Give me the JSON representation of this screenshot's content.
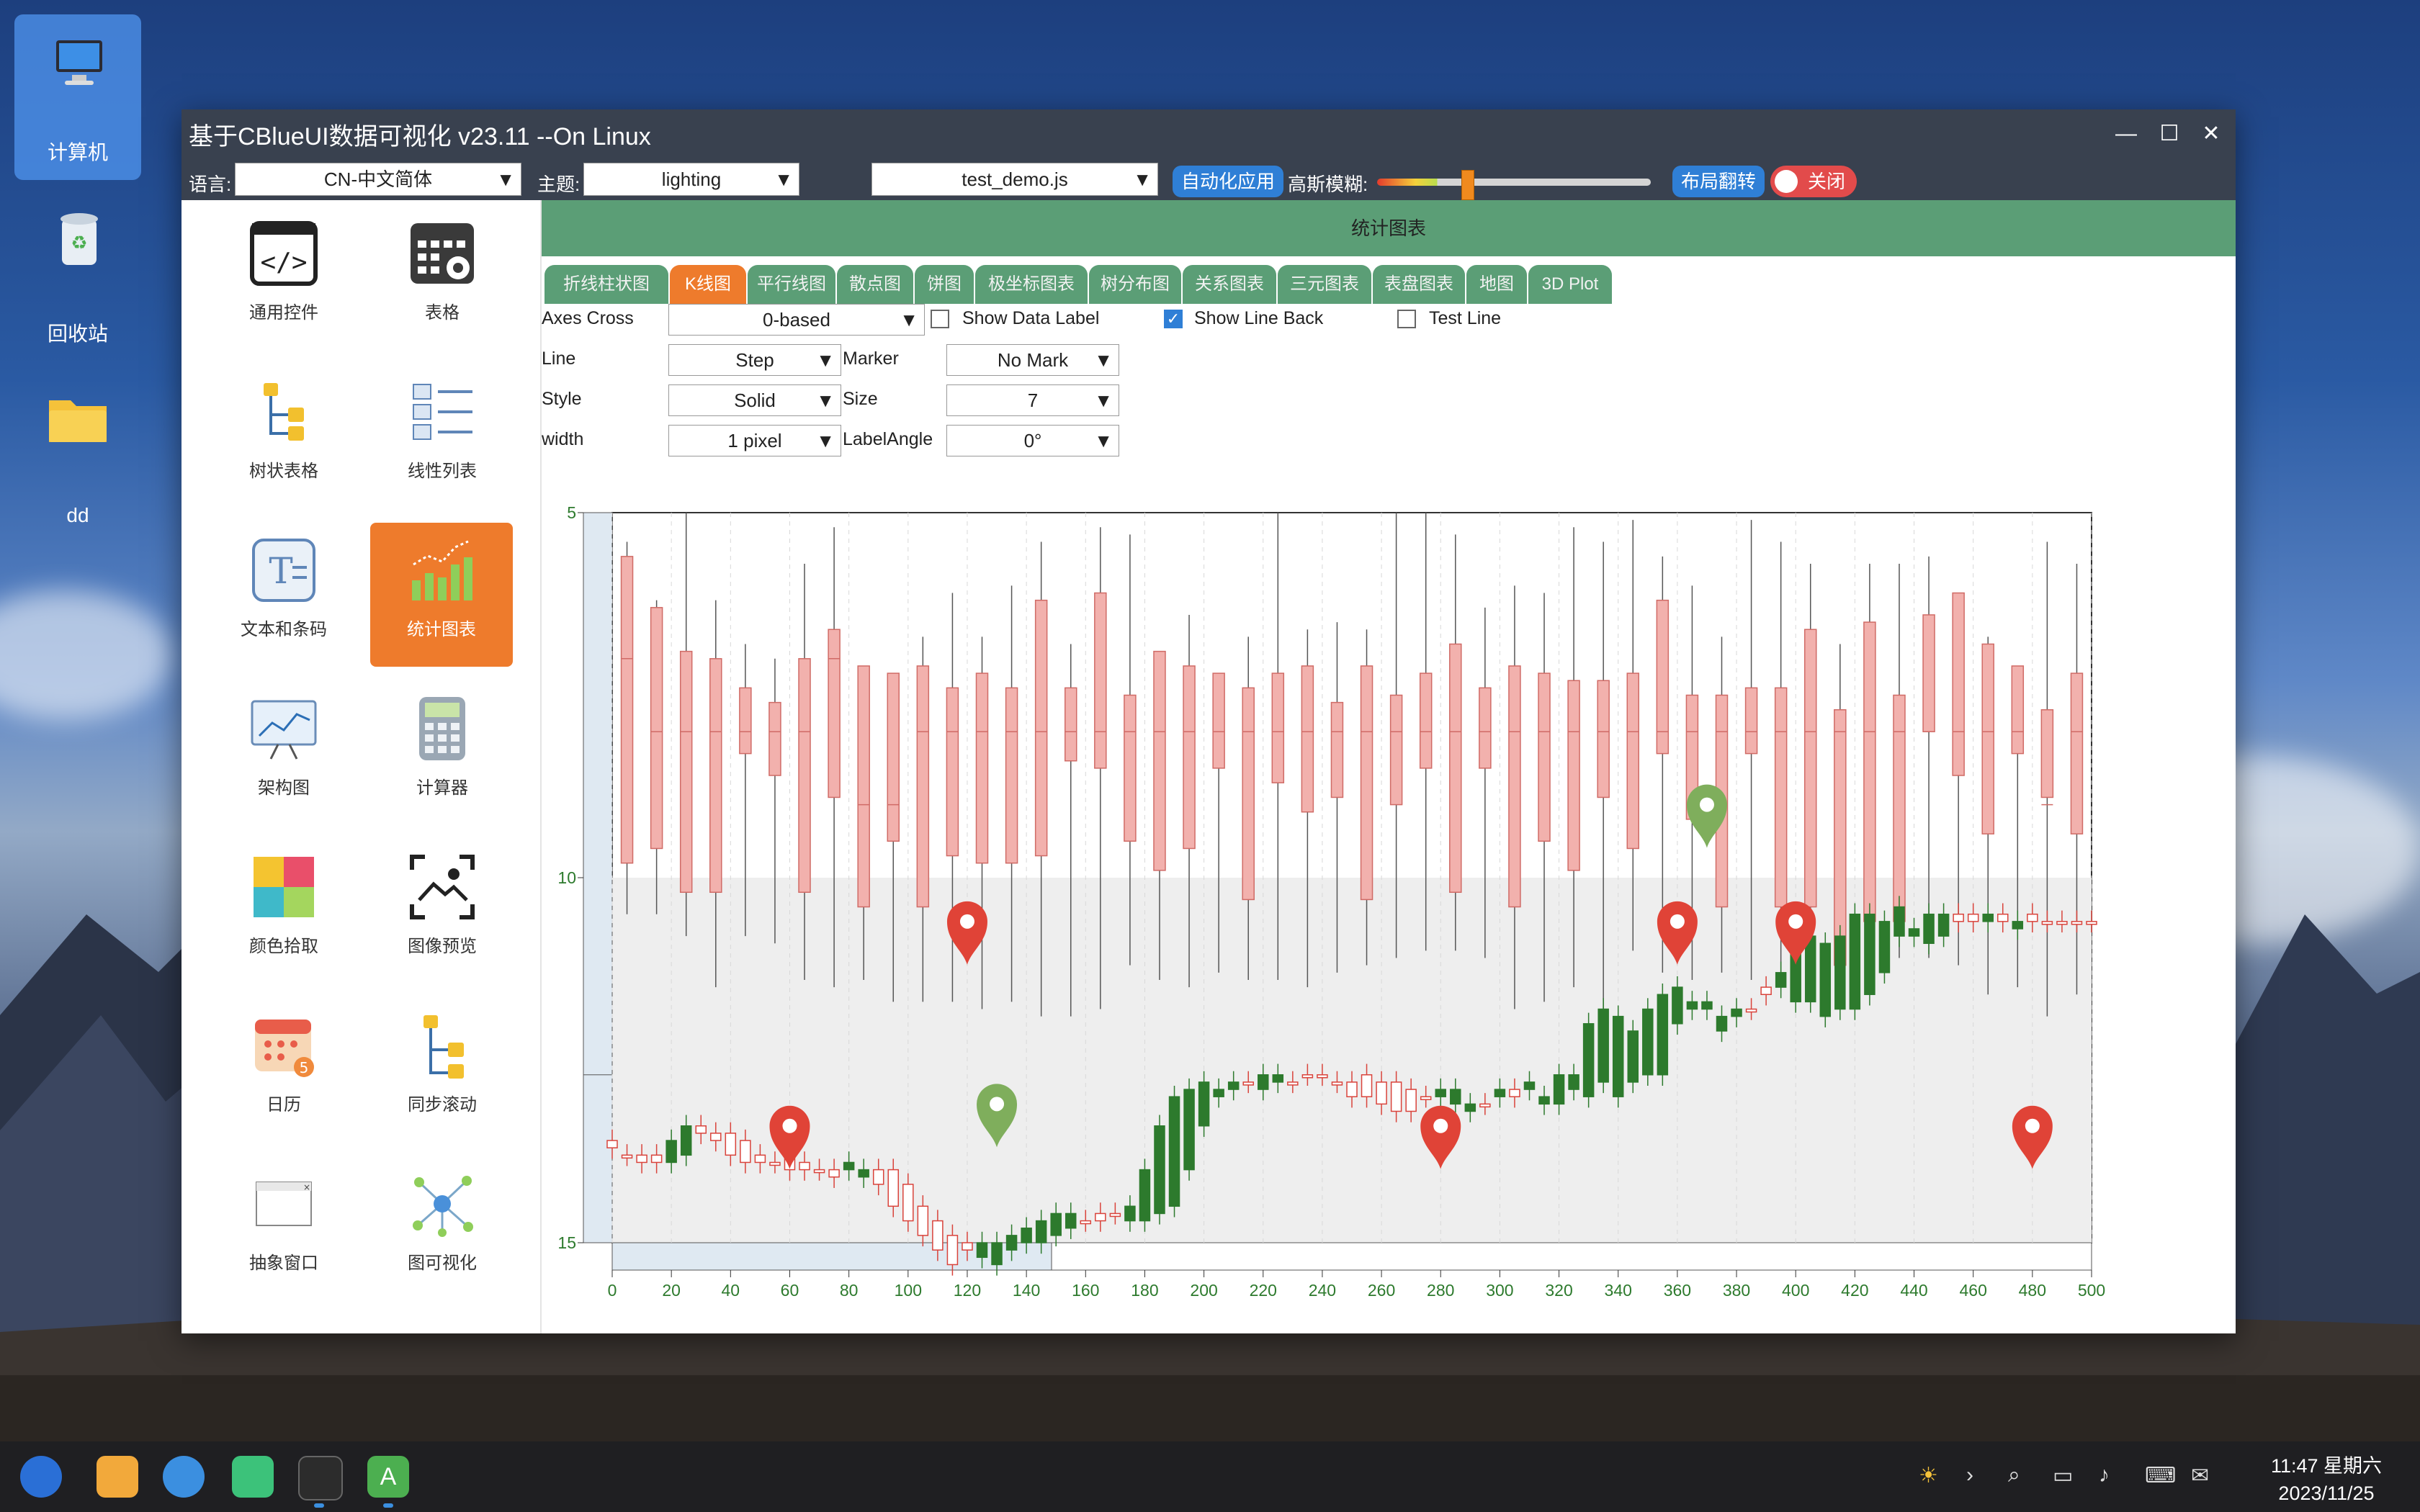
{
  "desktop": {
    "icons": [
      {
        "label": "计算机",
        "icon": "computer-icon"
      },
      {
        "label": "回收站",
        "icon": "trash-icon"
      },
      {
        "label": "dd",
        "icon": "folder-icon"
      }
    ]
  },
  "window": {
    "title": "基于CBlueUI数据可视化 v23.11 --On Linux",
    "controls": [
      "minimize-icon",
      "maximize-icon",
      "close-icon"
    ]
  },
  "toolbar": {
    "language_label": "语言:",
    "language_value": "CN-中文简体",
    "theme_label": "主题:",
    "theme_value": "lighting",
    "script_value": "test_demo.js",
    "auto_app_label": "自动化应用",
    "blur_label": "高斯模糊:",
    "blur_level": 0.33,
    "layout_flip_label": "布局翻转",
    "close_toggle_label": "关闭"
  },
  "nav": {
    "items": [
      {
        "label": "通用控件",
        "icon": "code-icon"
      },
      {
        "label": "表格",
        "icon": "table-settings-icon"
      },
      {
        "label": "树状表格",
        "icon": "tree-table-icon"
      },
      {
        "label": "线性列表",
        "icon": "list-icon"
      },
      {
        "label": "文本和条码",
        "icon": "text-icon"
      },
      {
        "label": "统计图表",
        "icon": "chart-icon"
      },
      {
        "label": "架构图",
        "icon": "architecture-icon"
      },
      {
        "label": "计算器",
        "icon": "calculator-icon"
      },
      {
        "label": "颜色拾取",
        "icon": "color-picker-icon"
      },
      {
        "label": "图像预览",
        "icon": "image-preview-icon"
      },
      {
        "label": "日历",
        "icon": "calendar-icon"
      },
      {
        "label": "同步滚动",
        "icon": "sync-scroll-icon"
      },
      {
        "label": "抽象窗口",
        "icon": "window-icon"
      },
      {
        "label": "图可视化",
        "icon": "graph-icon"
      }
    ],
    "calendar_badge": "5"
  },
  "main": {
    "header": "统计图表",
    "tabs": [
      "折线柱状图",
      "K线图",
      "平行线图",
      "散点图",
      "饼图",
      "极坐标图表",
      "树分布图",
      "关系图表",
      "三元图表",
      "表盘图表",
      "地图",
      "3D Plot"
    ],
    "active_tab": "K线图",
    "controls": {
      "axes_cross_label": "Axes Cross",
      "axes_cross_value": "0-based",
      "show_data_label": "Show Data Label",
      "show_line_back": "Show Line Back",
      "test_line": "Test Line",
      "line_label": "Line",
      "line_value": "Step",
      "marker_label": "Marker",
      "marker_value": "No Mark",
      "style_label": "Style",
      "style_value": "Solid",
      "size_label": "Size",
      "size_value": "7",
      "width_label": "width",
      "width_value": "1 pixel",
      "label_angle_label": "LabelAngle",
      "label_angle_value": "0°"
    }
  },
  "chart_data": {
    "type": "candlestick+boxplot",
    "x_ticks": [
      "0",
      "20",
      "40",
      "60",
      "80",
      "100",
      "120",
      "140",
      "160",
      "180",
      "200",
      "220",
      "240",
      "260",
      "280",
      "300",
      "320",
      "340",
      "360",
      "380",
      "400",
      "420",
      "440",
      "460",
      "480",
      "500"
    ],
    "y_ticks": [
      "5",
      "10",
      "15"
    ],
    "xlim": [
      0,
      500
    ],
    "ylim": [
      5,
      15
    ],
    "y_inverted": true,
    "boxplot_series": {
      "x": [
        0,
        10,
        20,
        30,
        40,
        50,
        60,
        70,
        80,
        90,
        100,
        110,
        120,
        130,
        140,
        150,
        160,
        170,
        180,
        190,
        200,
        210,
        220,
        230,
        240,
        250,
        260,
        270,
        280,
        290,
        300,
        310,
        320,
        330,
        340,
        350,
        360,
        370,
        380,
        390,
        400,
        410,
        420,
        430,
        440,
        450,
        460,
        470,
        480,
        490
      ],
      "q1": [
        5.6,
        6.3,
        6.9,
        7.0,
        7.4,
        7.6,
        7.0,
        6.6,
        7.1,
        7.2,
        7.1,
        7.4,
        7.2,
        7.4,
        6.2,
        7.4,
        6.1,
        7.5,
        6.9,
        7.1,
        7.2,
        7.4,
        7.2,
        7.1,
        7.6,
        7.1,
        7.5,
        7.2,
        6.8,
        7.4,
        7.1,
        7.2,
        7.3,
        7.3,
        7.2,
        6.2,
        7.5,
        7.5,
        7.4,
        7.4,
        6.6,
        7.7,
        6.5,
        7.5,
        6.4,
        6.1,
        6.8,
        7.1,
        7.7,
        7.2
      ],
      "median": [
        7.0,
        8.0,
        8.0,
        8.0,
        8.0,
        8.0,
        8.0,
        7.0,
        9.0,
        9.0,
        8.0,
        8.0,
        8.0,
        8.0,
        8.0,
        8.0,
        8.0,
        8.0,
        8.0,
        8.0,
        8.0,
        8.0,
        8.0,
        8.0,
        8.0,
        8.0,
        8.0,
        8.0,
        8.0,
        8.0,
        8.0,
        8.0,
        8.0,
        8.0,
        8.0,
        8.0,
        8.0,
        8.0,
        8.0,
        8.0,
        8.0,
        8.0,
        8.0,
        8.0,
        8.0,
        8.0,
        8.0,
        8.0,
        9.0,
        8.0
      ],
      "q3": [
        9.8,
        9.6,
        10.2,
        10.2,
        8.3,
        8.6,
        10.2,
        8.9,
        10.4,
        9.5,
        10.4,
        9.7,
        9.8,
        9.8,
        9.7,
        8.4,
        8.5,
        9.5,
        9.9,
        9.6,
        8.5,
        10.3,
        8.7,
        9.1,
        8.9,
        10.3,
        9.0,
        8.5,
        10.2,
        8.5,
        10.4,
        9.5,
        9.9,
        8.9,
        9.6,
        8.3,
        9.2,
        10.4,
        8.3,
        10.4,
        10.4,
        11.2,
        10.6,
        10.6,
        8.0,
        8.6,
        9.4,
        8.3,
        8.9,
        9.4
      ],
      "whisker_low": [
        10.5,
        10.5,
        10.8,
        11.5,
        10.8,
        10.9,
        11.4,
        11.5,
        11.4,
        11.7,
        11.7,
        11.7,
        11.8,
        11.7,
        11.9,
        11.9,
        11.8,
        11.2,
        11.4,
        11.5,
        11.3,
        11.4,
        11.4,
        11.5,
        11.3,
        11.2,
        11.1,
        11.0,
        11.0,
        11.1,
        11.8,
        11.7,
        11.5,
        11.8,
        11.0,
        11.3,
        11.4,
        11.3,
        11.4,
        11.4,
        11.7,
        11.8,
        11.0,
        11.1,
        11.1,
        11.2,
        11.6,
        11.5,
        11.9,
        11.6
      ],
      "whisker_high": [
        5.4,
        6.2,
        5.0,
        6.2,
        6.8,
        7.0,
        5.7,
        5.2,
        7.5,
        7.5,
        6.7,
        6.1,
        6.7,
        6.0,
        5.4,
        6.8,
        5.2,
        5.3,
        6.9,
        6.4,
        7.5,
        6.7,
        5.0,
        6.6,
        6.5,
        6.6,
        5.0,
        5.0,
        5.3,
        6.3,
        6.0,
        6.1,
        5.2,
        5.4,
        5.1,
        5.6,
        6.0,
        6.7,
        5.1,
        5.4,
        5.7,
        6.8,
        5.7,
        5.7,
        5.6,
        6.8,
        6.7,
        7.2,
        5.4,
        5.7
      ]
    },
    "candlestick_series": {
      "x": [
        0,
        5,
        10,
        15,
        20,
        25,
        30,
        35,
        40,
        45,
        50,
        55,
        60,
        65,
        70,
        75,
        80,
        85,
        90,
        95,
        100,
        105,
        110,
        115,
        120,
        125,
        130,
        135,
        140,
        145,
        150,
        155,
        160,
        165,
        170,
        175,
        180,
        185,
        190,
        195,
        200,
        205,
        210,
        215,
        220,
        225,
        230,
        235,
        240,
        245,
        250,
        255,
        260,
        265,
        270,
        275,
        280,
        285,
        290,
        295,
        300,
        305,
        310,
        315,
        320,
        325,
        330,
        335,
        340,
        345,
        350,
        355,
        360,
        365,
        370,
        375,
        380,
        385,
        390,
        395,
        400,
        405,
        410,
        415,
        420,
        425,
        430,
        435,
        440,
        445,
        450,
        455,
        460,
        465,
        470,
        475,
        480,
        485,
        490,
        495,
        500
      ],
      "open": [
        13.6,
        13.8,
        13.8,
        13.8,
        13.9,
        13.8,
        13.4,
        13.5,
        13.5,
        13.6,
        13.8,
        13.9,
        13.8,
        13.9,
        14.0,
        14.0,
        14.0,
        14.1,
        14.0,
        14.0,
        14.2,
        14.5,
        14.7,
        14.9,
        15.0,
        15.2,
        15.3,
        15.1,
        15.0,
        15.0,
        14.9,
        14.8,
        14.7,
        14.6,
        14.6,
        14.7,
        14.7,
        14.6,
        14.5,
        14.0,
        13.4,
        13.0,
        12.9,
        12.8,
        12.9,
        12.8,
        12.8,
        12.7,
        12.7,
        12.8,
        12.8,
        12.7,
        12.8,
        12.8,
        12.9,
        13.0,
        13.0,
        13.1,
        13.2,
        13.1,
        13.0,
        12.9,
        12.9,
        13.1,
        13.1,
        12.9,
        13.0,
        12.8,
        13.0,
        12.8,
        12.7,
        12.7,
        12.0,
        11.8,
        11.8,
        12.1,
        11.9,
        11.8,
        11.5,
        11.5,
        11.7,
        11.7,
        11.9,
        11.8,
        11.8,
        11.6,
        11.3,
        10.8,
        10.8,
        10.9,
        10.8,
        10.5,
        10.5,
        10.6,
        10.5,
        10.7,
        10.5,
        10.6,
        10.6,
        10.6,
        10.6
      ],
      "close": [
        13.7,
        13.8,
        13.9,
        13.9,
        13.6,
        13.4,
        13.5,
        13.6,
        13.8,
        13.9,
        13.9,
        13.9,
        14.0,
        14.0,
        14.0,
        14.1,
        13.9,
        14.0,
        14.2,
        14.5,
        14.7,
        14.9,
        15.1,
        15.3,
        15.1,
        15.0,
        15.0,
        14.9,
        14.8,
        14.7,
        14.6,
        14.6,
        14.7,
        14.7,
        14.6,
        14.5,
        14.0,
        13.4,
        13.0,
        12.9,
        12.8,
        12.9,
        12.8,
        12.8,
        12.7,
        12.7,
        12.8,
        12.7,
        12.7,
        12.8,
        13.0,
        13.0,
        13.1,
        13.2,
        13.2,
        13.0,
        12.9,
        12.9,
        13.1,
        13.1,
        12.9,
        13.0,
        12.8,
        13.0,
        12.7,
        12.7,
        12.0,
        11.8,
        11.9,
        12.1,
        11.8,
        11.6,
        11.5,
        11.7,
        11.7,
        11.9,
        11.8,
        11.8,
        11.6,
        11.3,
        10.9,
        10.8,
        10.9,
        10.8,
        10.5,
        10.5,
        10.6,
        10.4,
        10.7,
        10.5,
        10.5,
        10.6,
        10.6,
        10.5,
        10.6,
        10.6,
        10.6,
        10.6,
        10.6,
        10.6,
        10.6
      ]
    },
    "map_markers": [
      {
        "x": 60,
        "y": 13.4,
        "color": "red"
      },
      {
        "x": 120,
        "y": 10.6,
        "color": "red"
      },
      {
        "x": 130,
        "y": 13.1,
        "color": "green"
      },
      {
        "x": 280,
        "y": 13.4,
        "color": "red"
      },
      {
        "x": 360,
        "y": 10.6,
        "color": "red"
      },
      {
        "x": 370,
        "y": 9.0,
        "color": "green"
      },
      {
        "x": 400,
        "y": 10.6,
        "color": "red"
      },
      {
        "x": 480,
        "y": 13.4,
        "color": "red"
      }
    ],
    "shaded_band": {
      "y_from": 10,
      "y_to": 15
    },
    "grid": true
  },
  "taskbar": {
    "apps": [
      "launcher-icon",
      "app-store-icon",
      "browser-icon",
      "chat-icon",
      "terminal-icon",
      "a-app-icon"
    ],
    "time": "11:47 星期六",
    "date": "2023/11/25"
  },
  "colors": {
    "titlebar": "#39414f",
    "accent_green": "#5b9e76",
    "accent_orange": "#ee7b2c",
    "candle_up": "#2d7a2d",
    "candle_down": "#d9433b",
    "box_fill": "#f2b1ad",
    "box_stroke": "#d06b66"
  }
}
